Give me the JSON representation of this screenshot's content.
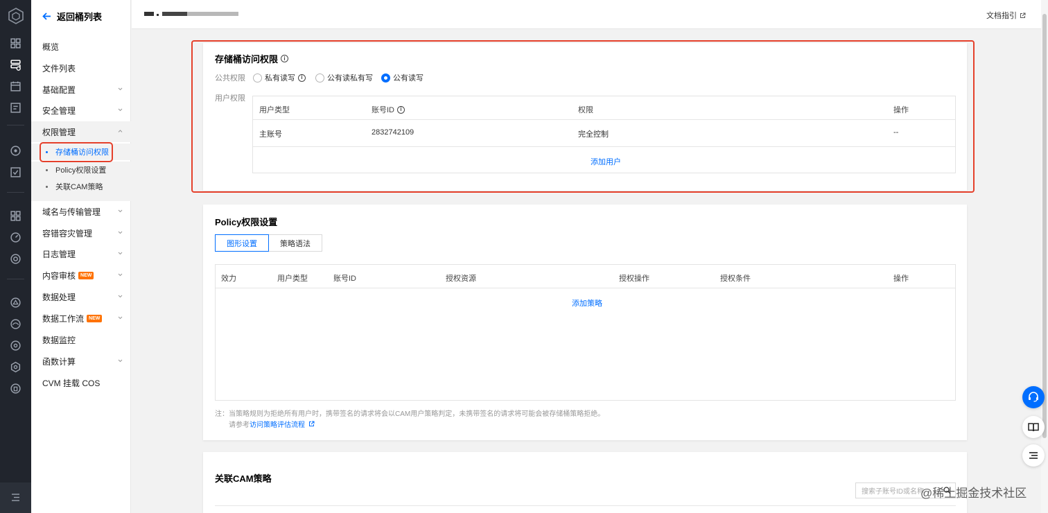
{
  "sidebar": {
    "back_label": "返回桶列表",
    "items": [
      {
        "label": "概览"
      },
      {
        "label": "文件列表"
      },
      {
        "label": "基础配置"
      },
      {
        "label": "安全管理"
      },
      {
        "label": "权限管理"
      },
      {
        "label": "域名与传输管理"
      },
      {
        "label": "容错容灾管理"
      },
      {
        "label": "日志管理"
      },
      {
        "label": "内容审核",
        "badge": "NEW"
      },
      {
        "label": "数据处理"
      },
      {
        "label": "数据工作流",
        "badge": "NEW"
      },
      {
        "label": "数据监控"
      },
      {
        "label": "函数计算"
      },
      {
        "label": "CVM 挂载 COS"
      }
    ],
    "sub_items": [
      "存储桶访问权限",
      "Policy权限设置",
      "关联CAM策略"
    ],
    "active_sub": "存储桶访问权限"
  },
  "topbar": {
    "doc_link": "文档指引"
  },
  "bucket_acl": {
    "title": "存储桶访问权限",
    "public_label": "公共权限",
    "user_label": "用户权限",
    "options": [
      "私有读写",
      "公有读私有写",
      "公有读写"
    ],
    "selected": "公有读写",
    "columns": [
      "用户类型",
      "账号ID",
      "权限",
      "操作"
    ],
    "rows": [
      {
        "type": "主账号",
        "id": "2832742109",
        "perm": "完全控制",
        "op": "--"
      }
    ],
    "add_user": "添加用户"
  },
  "policy": {
    "title": "Policy权限设置",
    "tabs": [
      "图形设置",
      "策略语法"
    ],
    "active_tab": "图形设置",
    "columns": [
      "效力",
      "用户类型",
      "账号ID",
      "授权资源",
      "授权操作",
      "授权条件",
      "操作"
    ],
    "add_policy": "添加策略",
    "note": "注：当策略规则为拒绝所有用户时，携带签名的请求将会以CAM用户策略判定，未携带签名的请求将可能会被存储桶策略拒绝。",
    "ref_prefix": "请参考",
    "ref_link": "访问策略评估流程"
  },
  "cam": {
    "title": "关联CAM策略",
    "search_placeholder": "搜索子账号ID或名称"
  },
  "watermark": "@稀土掘金技术社区",
  "colors": {
    "accent": "#006eff",
    "highlight": "#e5402b",
    "rail": "#21252d",
    "badge": "#ff7200"
  }
}
